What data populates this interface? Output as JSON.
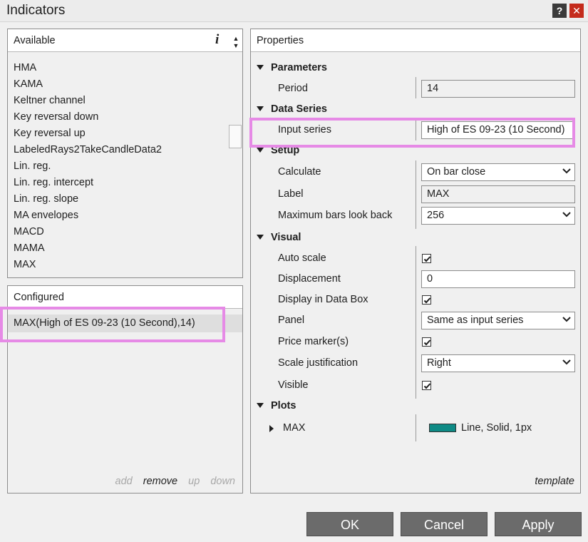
{
  "window": {
    "title": "Indicators",
    "help_label": "?",
    "close_label": "✕"
  },
  "available": {
    "header": "Available",
    "info_icon": "i",
    "items": [
      "HMA",
      "KAMA",
      "Keltner channel",
      "Key reversal down",
      "Key reversal up",
      "LabeledRays2TakeCandleData2",
      "Lin. reg.",
      "Lin. reg. intercept",
      "Lin. reg. slope",
      "MA envelopes",
      "MACD",
      "MAMA",
      "MAX"
    ]
  },
  "configured": {
    "header": "Configured",
    "items": [
      "MAX(High of ES 09-23 (10 Second),14)"
    ],
    "actions": {
      "add": "add",
      "remove": "remove",
      "up": "up",
      "down": "down"
    }
  },
  "properties": {
    "header": "Properties",
    "categories": {
      "parameters": "Parameters",
      "data_series": "Data Series",
      "setup": "Setup",
      "visual": "Visual",
      "plots": "Plots"
    },
    "period": {
      "label": "Period",
      "value": "14"
    },
    "input_series": {
      "label": "Input series",
      "value": "High of ES 09-23 (10 Second)"
    },
    "calculate": {
      "label": "Calculate",
      "value": "On bar close"
    },
    "label_field": {
      "label": "Label",
      "value": "MAX"
    },
    "max_bars": {
      "label": "Maximum bars look back",
      "value": "256"
    },
    "auto_scale": {
      "label": "Auto scale",
      "checked": true
    },
    "displacement": {
      "label": "Displacement",
      "value": "0"
    },
    "display_in_data_box": {
      "label": "Display in Data Box",
      "checked": true
    },
    "panel": {
      "label": "Panel",
      "value": "Same as input series"
    },
    "price_markers": {
      "label": "Price marker(s)",
      "checked": true
    },
    "scale_justification": {
      "label": "Scale justification",
      "value": "Right"
    },
    "visible": {
      "label": "Visible",
      "checked": true
    },
    "plot": {
      "name": "MAX",
      "description": "Line, Solid, 1px",
      "color": "#0e8a85"
    },
    "template_link": "template"
  },
  "buttons": {
    "ok": "OK",
    "cancel": "Cancel",
    "apply": "Apply"
  },
  "colors": {
    "highlight": "#e68ae6",
    "button_bg": "#6b6b6b",
    "close_bg": "#c42b1c"
  }
}
